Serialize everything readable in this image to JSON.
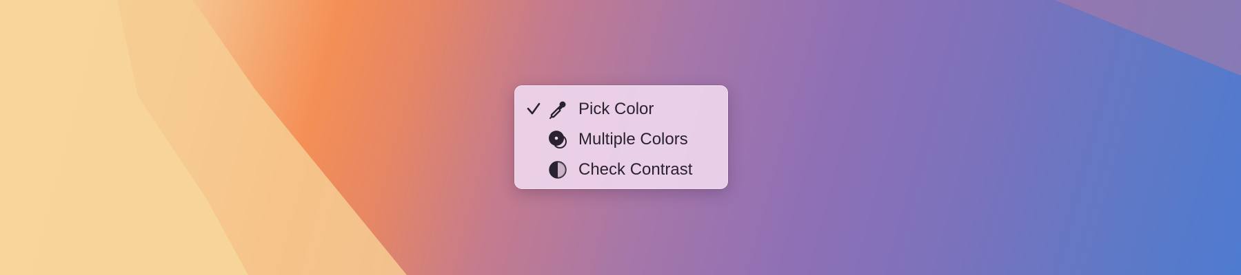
{
  "desktop": {
    "wallpaper": "macOS Sonoma gradient wallpaper"
  },
  "context_menu": {
    "items": [
      {
        "label": "Pick Color",
        "icon": "eyedropper-icon",
        "checked": true
      },
      {
        "label": "Multiple Colors",
        "icon": "multiple-colors-icon",
        "checked": false
      },
      {
        "label": "Check Contrast",
        "icon": "contrast-icon",
        "checked": false
      }
    ]
  },
  "colors": {
    "menu_background": "#eed6ec",
    "menu_text": "#2a2230"
  }
}
